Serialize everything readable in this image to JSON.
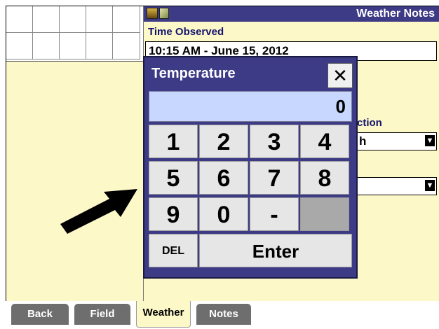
{
  "header": {
    "title": "Weather Notes"
  },
  "form": {
    "time_label": "Time Observed",
    "time_value": "10:15 AM - June 15, 2012",
    "direction_label_partial": "ction",
    "direction_value_partial": "h"
  },
  "keypad": {
    "title": "Temperature",
    "close_label": "✕",
    "display_value": "0",
    "keys": {
      "k1": "1",
      "k2": "2",
      "k3": "3",
      "k4": "4",
      "k5": "5",
      "k6": "6",
      "k7": "7",
      "k8": "8",
      "k9": "9",
      "k0": "0",
      "minus": "-",
      "del": "DEL",
      "enter": "Enter"
    }
  },
  "tabs": {
    "back": "Back",
    "field": "Field",
    "weather": "Weather",
    "notes": "Notes"
  }
}
